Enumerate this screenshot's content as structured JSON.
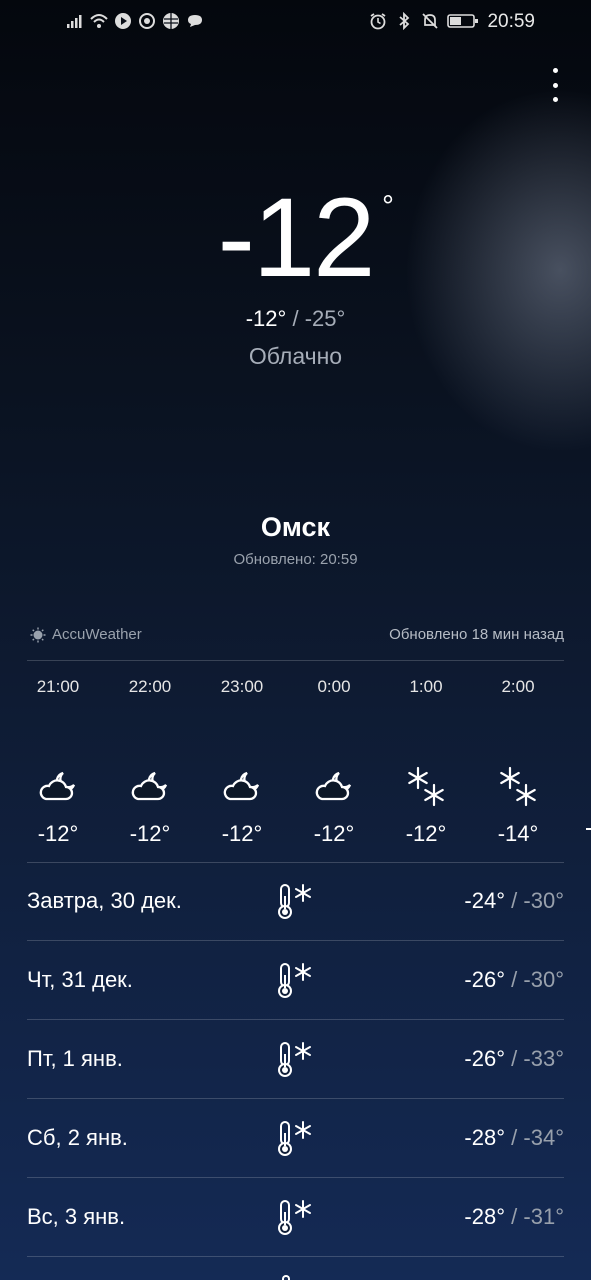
{
  "status_bar": {
    "time": "20:59",
    "left_icons": [
      "signal-icon",
      "wifi-icon",
      "play-icon",
      "sync-icon",
      "globe-icon",
      "chat-icon"
    ],
    "right_icons": [
      "alarm-icon",
      "bluetooth-icon",
      "mute-icon",
      "battery-icon"
    ]
  },
  "current": {
    "temperature": "-12",
    "degree_symbol": "°",
    "high": "-12°",
    "separator": "/",
    "low": "-25°",
    "condition": "Облачно",
    "city": "Омск",
    "updated": "Обновлено: 20:59"
  },
  "provider": {
    "name": "AccuWeather",
    "updated": "Обновлено 18 мин назад"
  },
  "hourly": [
    {
      "time": "21:00",
      "icon": "cloudy-night-icon",
      "temp": "-12°"
    },
    {
      "time": "22:00",
      "icon": "cloudy-night-icon",
      "temp": "-12°"
    },
    {
      "time": "23:00",
      "icon": "cloudy-night-icon",
      "temp": "-12°"
    },
    {
      "time": "0:00",
      "icon": "cloudy-night-icon",
      "temp": "-12°"
    },
    {
      "time": "1:00",
      "icon": "snowflakes-icon",
      "temp": "-12°"
    },
    {
      "time": "2:00",
      "icon": "snowflakes-icon",
      "temp": "-14°"
    }
  ],
  "daily": [
    {
      "label": "Завтра, 30 дек.",
      "icon": "frost-thermometer-icon",
      "high": "-24°",
      "separator": "/",
      "low": "-30°"
    },
    {
      "label": "Чт, 31 дек.",
      "icon": "frost-thermometer-icon",
      "high": "-26°",
      "separator": "/",
      "low": "-30°"
    },
    {
      "label": "Пт, 1 янв.",
      "icon": "frost-thermometer-icon",
      "high": "-26°",
      "separator": "/",
      "low": "-33°"
    },
    {
      "label": "Сб, 2 янв.",
      "icon": "frost-thermometer-icon",
      "high": "-28°",
      "separator": "/",
      "low": "-34°"
    },
    {
      "label": "Вс, 3 янв.",
      "icon": "frost-thermometer-icon",
      "high": "-28°",
      "separator": "/",
      "low": "-31°"
    }
  ],
  "colors": {
    "text_primary": "#ffffff",
    "text_secondary": "#a6adb8",
    "background_top": "#04070d",
    "background_bottom": "#142a55"
  }
}
